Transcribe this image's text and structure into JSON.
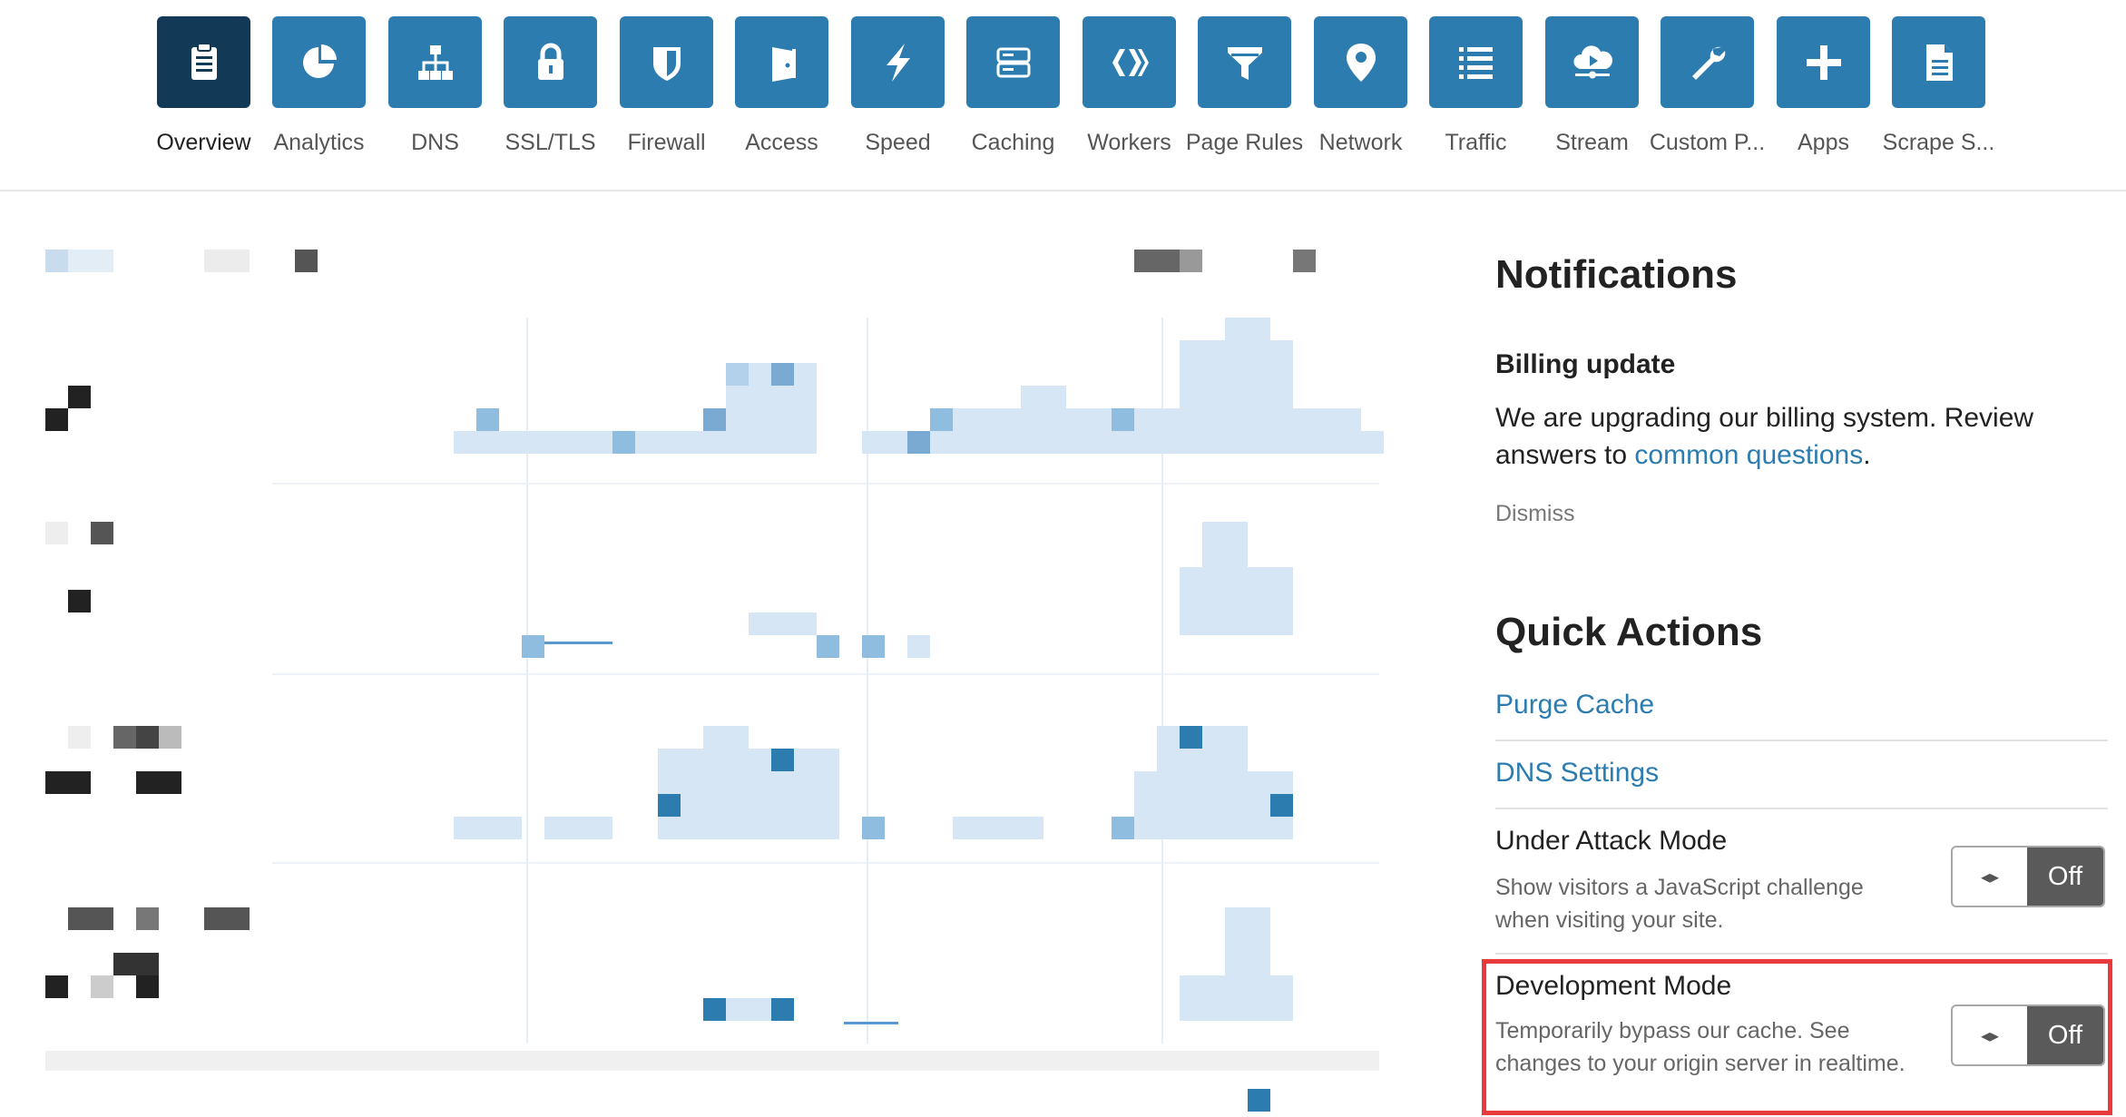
{
  "nav": {
    "items": [
      {
        "label": "Overview",
        "icon": "clipboard-icon",
        "active": true
      },
      {
        "label": "Analytics",
        "icon": "pie-chart-icon"
      },
      {
        "label": "DNS",
        "icon": "network-tree-icon"
      },
      {
        "label": "SSL/TLS",
        "icon": "lock-icon"
      },
      {
        "label": "Firewall",
        "icon": "shield-icon"
      },
      {
        "label": "Access",
        "icon": "door-icon"
      },
      {
        "label": "Speed",
        "icon": "lightning-icon"
      },
      {
        "label": "Caching",
        "icon": "server-icon"
      },
      {
        "label": "Workers",
        "icon": "workers-icon"
      },
      {
        "label": "Page Rules",
        "icon": "filter-icon"
      },
      {
        "label": "Network",
        "icon": "map-pin-icon"
      },
      {
        "label": "Traffic",
        "icon": "list-icon"
      },
      {
        "label": "Stream",
        "icon": "cloud-play-icon"
      },
      {
        "label": "Custom P...",
        "icon": "wrench-icon"
      },
      {
        "label": "Apps",
        "icon": "plus-icon"
      },
      {
        "label": "Scrape S...",
        "icon": "document-icon"
      }
    ]
  },
  "notifications": {
    "title": "Notifications",
    "billing_title": "Billing update",
    "billing_text": "We are upgrading our billing system. Review answers to",
    "billing_link": "common questions",
    "billing_end": ".",
    "dismiss": "Dismiss"
  },
  "quick_actions": {
    "title": "Quick Actions",
    "purge_cache": "Purge Cache",
    "dns_settings": "DNS Settings",
    "under_attack": {
      "title": "Under Attack Mode",
      "description": "Show visitors a JavaScript challenge when visiting your site.",
      "state": "Off"
    },
    "dev_mode": {
      "title": "Development Mode",
      "description": "Temporarily bypass our cache. See changes to your origin server in realtime.",
      "state": "Off"
    }
  },
  "colors": {
    "accent": "#2c7cb0",
    "active_tile": "#123a57",
    "highlight": "#e83a3a"
  }
}
